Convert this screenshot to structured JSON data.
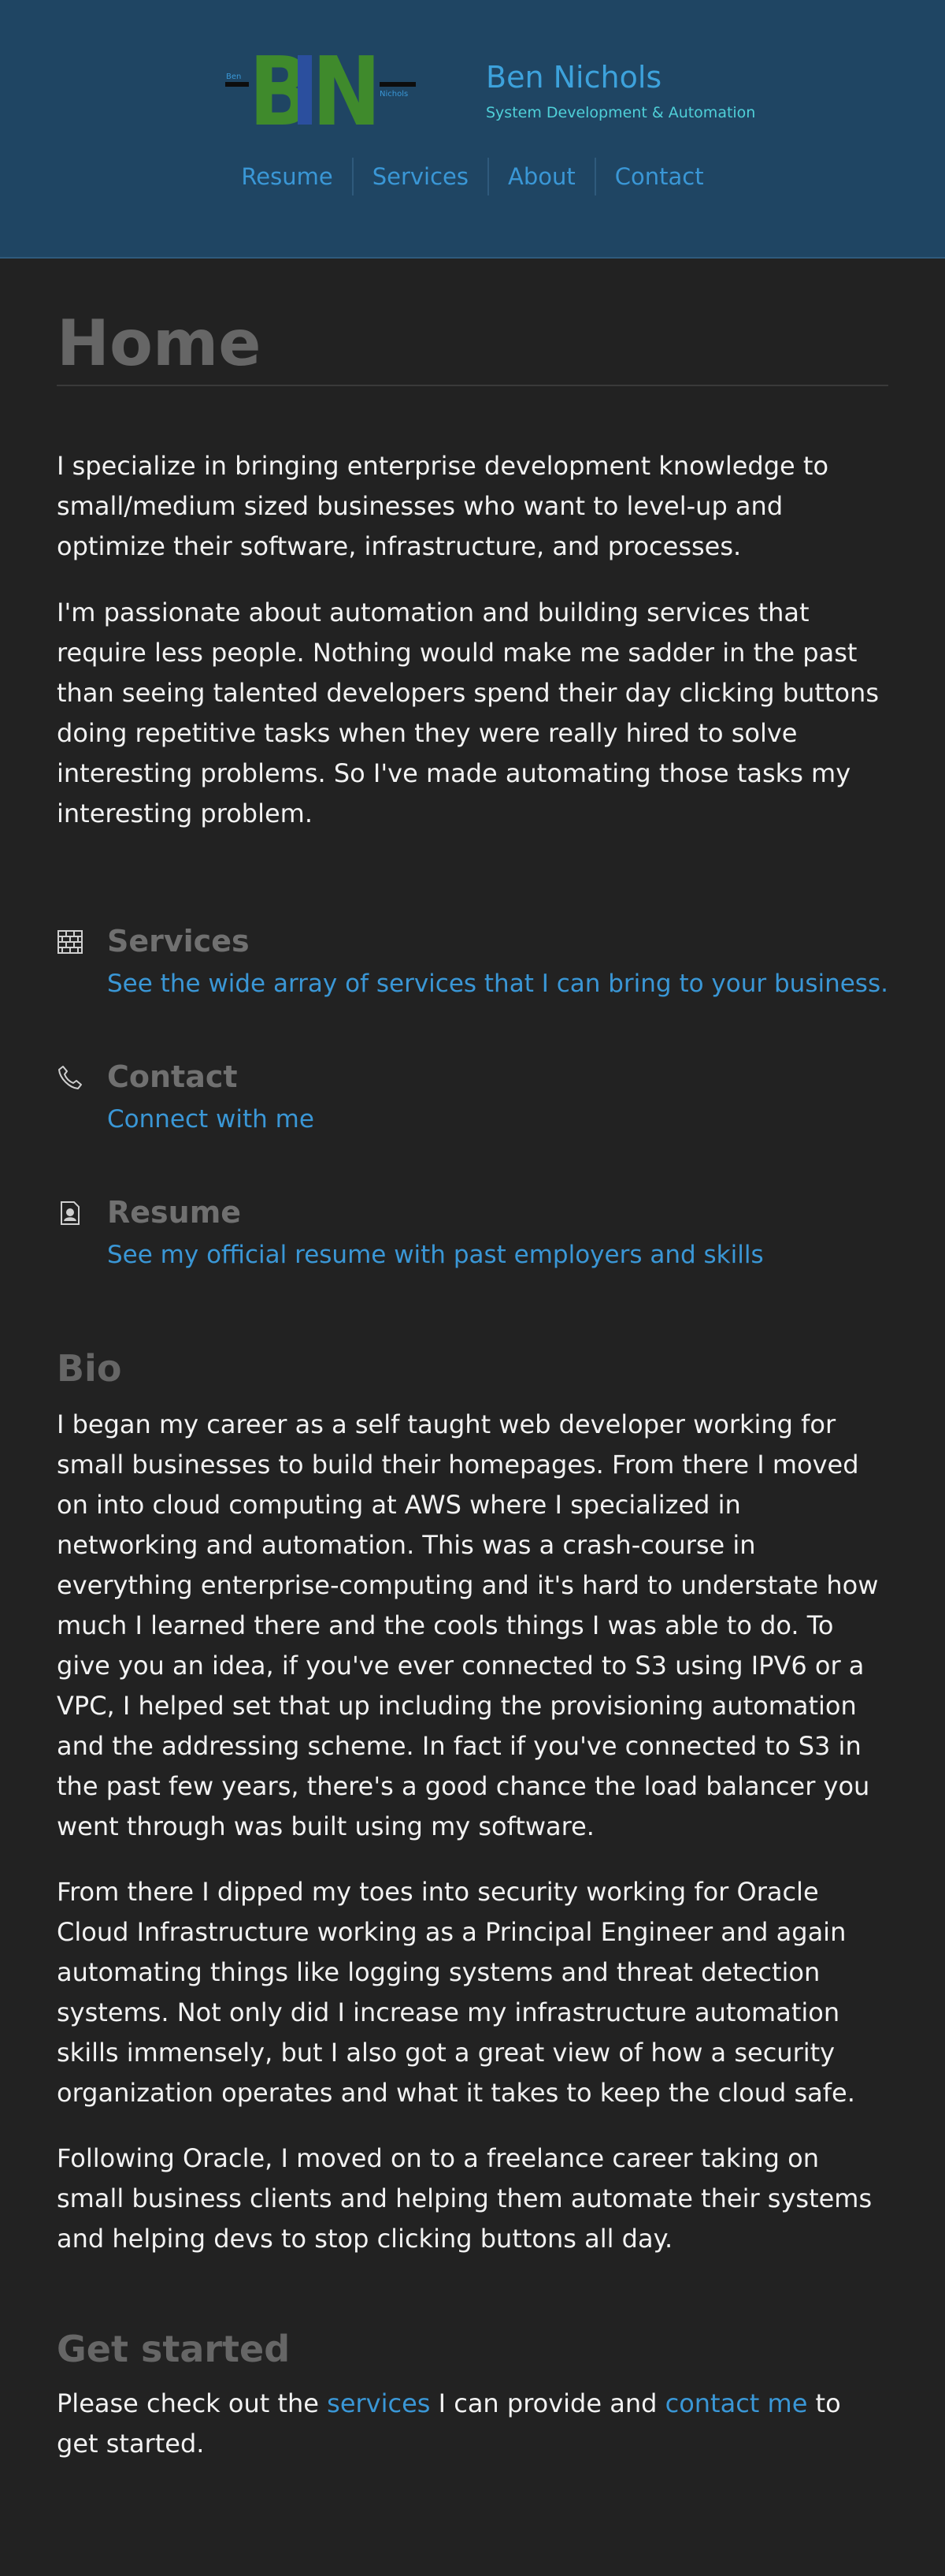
{
  "header": {
    "logo": {
      "big_letters": "BN",
      "left_small": "Ben",
      "right_small": "Nichols"
    },
    "name": "Ben Nichols",
    "tagline": "System Development & Automation"
  },
  "nav": [
    {
      "label": "Resume"
    },
    {
      "label": "Services"
    },
    {
      "label": "About"
    },
    {
      "label": "Contact"
    }
  ],
  "page": {
    "title": "Home",
    "intro": [
      "I specialize in bringing enterprise development knowledge to small/medium sized businesses who want to level-up and optimize their software, infrastructure, and processes.",
      "I'm passionate about automation and building services that require less people. Nothing would make me sadder in the past than seeing talented developers spend their day clicking buttons doing repetitive tasks when they were really hired to solve interesting problems. So I've made automating those tasks my interesting problem."
    ]
  },
  "cards": [
    {
      "icon": "brick-wall-icon",
      "title": "Services",
      "link": "See the wide array of services that I can bring to your business."
    },
    {
      "icon": "phone-icon",
      "title": "Contact",
      "link": "Connect with me"
    },
    {
      "icon": "resume-badge-icon",
      "title": "Resume",
      "link": "See my official resume with past employers and skills"
    }
  ],
  "bio": {
    "heading": "Bio",
    "paragraphs": [
      "I began my career as a self taught web developer working for small businesses to build their homepages. From there I moved on into cloud computing at AWS where I specialized in networking and automation. This was a crash-course in everything enterprise-computing and it's hard to understate how much I learned there and the cools things I was able to do. To give you an idea, if you've ever connected to S3 using IPV6 or a VPC, I helped set that up including the provisioning automation and the addressing scheme. In fact if you've connected to S3 in the past few years, there's a good chance the load balancer you went through was built using my software.",
      "From there I dipped my toes into security working for Oracle Cloud Infrastructure working as a Principal Engineer and again automating things like logging systems and threat detection systems. Not only did I increase my infrastructure automation skills immensely, but I also got a great view of how a security organization operates and what it takes to keep the cloud safe.",
      "Following Oracle, I moved on to a freelance career taking on small business clients and helping them automate their systems and helping devs to stop clicking buttons all day."
    ]
  },
  "get_started": {
    "heading": "Get started",
    "text_before": "Please check out the ",
    "services_link": "services",
    "text_middle": " I can provide and ",
    "contact_link": "contact me",
    "text_after": " to get started."
  },
  "colors": {
    "header_bg": "#1f4563",
    "page_bg": "#222222",
    "link": "#3a97d6",
    "heading": "#666666",
    "logo_green": "#3f8a2c",
    "logo_blue": "#2b4f9e",
    "tagline": "#4fd0d8"
  }
}
